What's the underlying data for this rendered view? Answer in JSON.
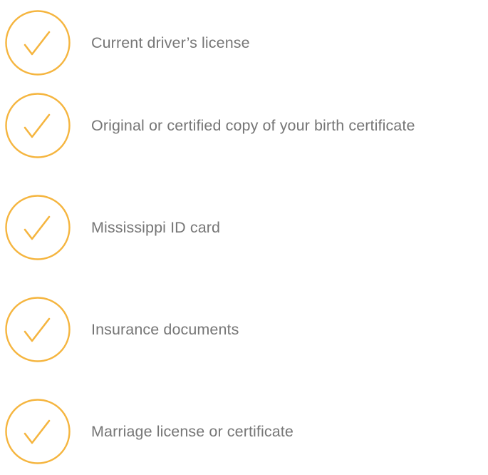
{
  "colors": {
    "check_accent": "#F5B53F",
    "label_text": "#767676",
    "background": "#FFFFFF"
  },
  "checklist": {
    "items": [
      {
        "icon": "checkmark-circle-icon",
        "label": "Current driver’s license"
      },
      {
        "icon": "checkmark-circle-icon",
        "label": "Original or certified copy of your birth certificate"
      },
      {
        "icon": "checkmark-circle-icon",
        "label": "Mississippi ID card"
      },
      {
        "icon": "checkmark-circle-icon",
        "label": "Insurance documents"
      },
      {
        "icon": "checkmark-circle-icon",
        "label": "Marriage license or certificate"
      }
    ]
  }
}
